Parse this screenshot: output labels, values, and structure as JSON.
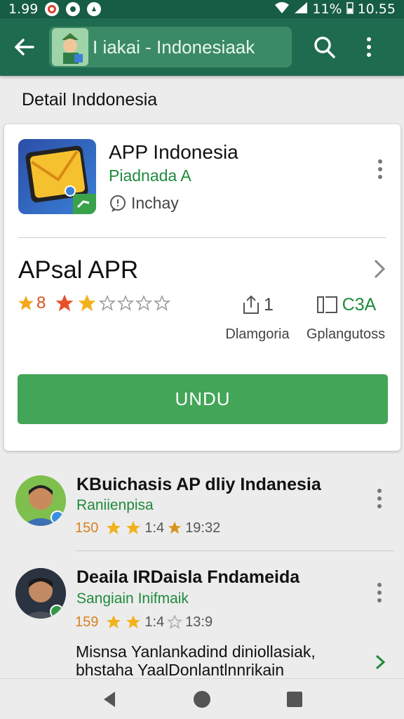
{
  "statusbar": {
    "left_time": "1.99",
    "battery": "11%",
    "time": "10.55"
  },
  "toolbar": {
    "search_text": "I iakai - Indonesiaak"
  },
  "section_title": "Detail Inddonesia",
  "app": {
    "title": "APP Indonesia",
    "developer": "Piadnada A",
    "sub_label": "Inchay",
    "rating_title": "APsal APR",
    "rating_letter": "8",
    "stat1_value": "1",
    "stat1_label": "Dlamgoria",
    "stat2_value": "C3A",
    "stat2_label": "Gplangutoss",
    "install_label": "UNDU"
  },
  "reviews": [
    {
      "title": "KBuichasis AP dliy Indanesia",
      "subtitle": "Raniienpisa",
      "count": "150",
      "score": "1:4",
      "time": "19:32"
    },
    {
      "title": "Deaila IRDaisla Fndameida",
      "subtitle": "Sangiain Inifmaik",
      "count": "159",
      "score": "1:4",
      "time": "13:9",
      "body": "Misnsa Yanlankadind diniollasiak, bhstaha YaalDonlantlnnrikain"
    }
  ],
  "colors": {
    "toolbar": "#1e6b4f",
    "statusbar": "#175c45",
    "accent_green": "#43a557",
    "star": "#f2b21c"
  },
  "icons": [
    "back-arrow-icon",
    "search-icon",
    "more-vert-icon",
    "chat-bubble-icon",
    "share-icon",
    "compare-icon",
    "chevron-right-icon",
    "star-icon",
    "nav-back-icon",
    "nav-home-icon",
    "nav-recents-icon"
  ]
}
